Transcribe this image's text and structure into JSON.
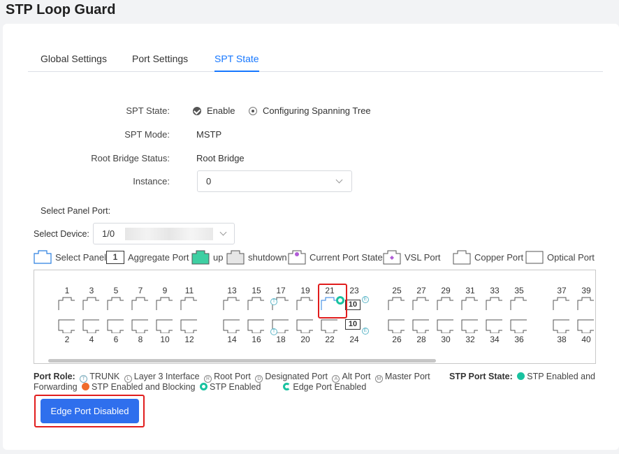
{
  "page": {
    "title": "STP Loop Guard"
  },
  "tabs": [
    {
      "label": "Global Settings",
      "active": false
    },
    {
      "label": "Port Settings",
      "active": false
    },
    {
      "label": "SPT State",
      "active": true
    }
  ],
  "form": {
    "spt_state": {
      "label": "SPT State:",
      "options": [
        "Enable",
        "Configuring Spanning Tree"
      ]
    },
    "spt_mode": {
      "label": "SPT Mode:",
      "value": "MSTP"
    },
    "root_bridge": {
      "label": "Root Bridge Status:",
      "value": "Root Bridge"
    },
    "instance": {
      "label": "Instance:",
      "value": "0"
    }
  },
  "panel": {
    "select_label": "Select Panel Port:",
    "device_label": "Select Device:",
    "device_value": "1/0"
  },
  "legend": {
    "select_panel": "Select Panel",
    "aggregate_port": "Aggregate Port",
    "aggregate_icon_text": "1",
    "up": "up",
    "shutdown": "shutdown",
    "current_state": "Current Port State",
    "vsl_port": "VSL Port",
    "copper_port": "Copper Port",
    "optical_port": "Optical Port"
  },
  "ports": {
    "top_numbers": [
      "1",
      "3",
      "5",
      "7",
      "9",
      "11",
      "13",
      "15",
      "17",
      "19",
      "21",
      "23",
      "25",
      "27",
      "29",
      "31",
      "33",
      "35",
      "37",
      "39"
    ],
    "bottom_numbers": [
      "2",
      "4",
      "6",
      "8",
      "10",
      "12",
      "14",
      "16",
      "18",
      "20",
      "22",
      "24",
      "26",
      "28",
      "30",
      "32",
      "34",
      "36",
      "38",
      "40"
    ],
    "aggregate_label": "10",
    "trunk_glyph": "T",
    "edge_glyph": "E"
  },
  "port_role": {
    "title": "Port Role:",
    "trunk": "TRUNK",
    "layer3": "Layer 3 Interface",
    "root": "Root Port",
    "designated": "Designated Port",
    "alt": "Alt Port",
    "master": "Master Port",
    "trunk_glyph": "T",
    "layer3_glyph": "L",
    "root_glyph": "R",
    "designated_glyph": "D",
    "alt_glyph": "A",
    "master_glyph": "M"
  },
  "stp_state": {
    "title": "STP Port State:",
    "enabled_forwarding_1": "STP Enabled and",
    "enabled_forwarding_2": "Forwarding",
    "blocking": "STP Enabled and Blocking",
    "enabled": "STP Enabled",
    "edge": "Edge Port Enabled"
  },
  "actions": {
    "edge_port_button": "Edge Port Disabled"
  },
  "colors": {
    "accent": "#1677ff",
    "button": "#2f6fed",
    "highlight": "#e11d1d",
    "stp_green": "#19c2a0",
    "blocking": "#f06c2c"
  }
}
